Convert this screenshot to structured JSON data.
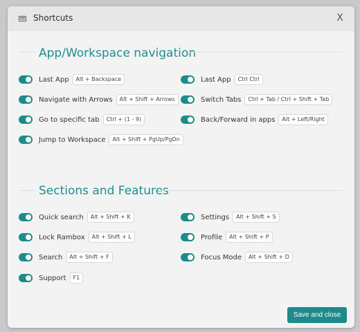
{
  "dialog": {
    "title": "Shortcuts",
    "close_label": "X",
    "save_label": "Save and close"
  },
  "colors": {
    "accent": "#1e8a8a",
    "heading": "#1e8e8e"
  },
  "sections": [
    {
      "title": "App/Workspace navigation",
      "left": [
        {
          "label": "Last App",
          "key": "Alt + Backspace",
          "enabled": true
        },
        {
          "label": "Navigate with Arrows",
          "key": "Alt + Shift + Arrows",
          "enabled": true
        },
        {
          "label": "Go to specific tab",
          "key": "Ctrl + (1 - 9)",
          "enabled": true
        },
        {
          "label": "Jump to Workspace",
          "key": "Alt + Shift + PgUp/PgDn",
          "enabled": true
        }
      ],
      "right": [
        {
          "label": "Last App",
          "key": "Ctrl Ctrl",
          "enabled": true
        },
        {
          "label": "Switch Tabs",
          "key": "Ctrl + Tab / Ctrl + Shift + Tab",
          "enabled": true
        },
        {
          "label": "Back/Forward in apps",
          "key": "Alt + Left/Right",
          "enabled": true
        }
      ]
    },
    {
      "title": "Sections and Features",
      "left": [
        {
          "label": "Quick search",
          "key": "Alt + Shift + K",
          "enabled": true
        },
        {
          "label": "Lock Rambox",
          "key": "Alt + Shift + L",
          "enabled": true
        },
        {
          "label": "Search",
          "key": "Alt + Shift + F",
          "enabled": true
        },
        {
          "label": "Support",
          "key": "F1",
          "enabled": true
        }
      ],
      "right": [
        {
          "label": "Settings",
          "key": "Alt + Shift + S",
          "enabled": true
        },
        {
          "label": "Profile",
          "key": "Alt + Shift + P",
          "enabled": true
        },
        {
          "label": "Focus Mode",
          "key": "Alt + Shift + D",
          "enabled": true
        }
      ]
    }
  ]
}
